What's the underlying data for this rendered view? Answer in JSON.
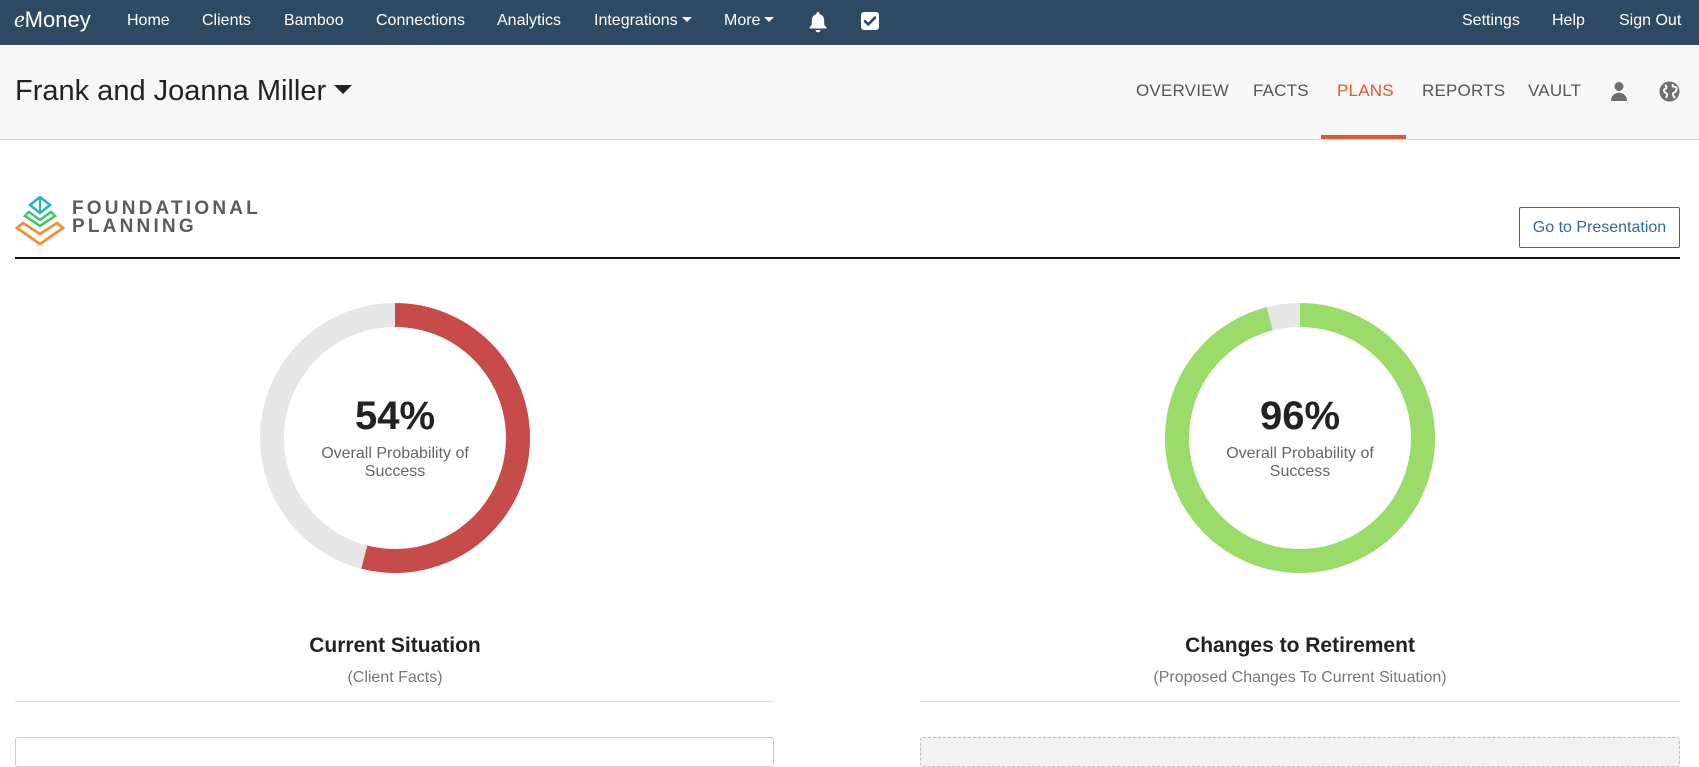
{
  "topnav": {
    "brand_e": "e",
    "brand_rest": "Money",
    "items": [
      {
        "label": "Home"
      },
      {
        "label": "Clients"
      },
      {
        "label": "Bamboo"
      },
      {
        "label": "Connections"
      },
      {
        "label": "Analytics"
      },
      {
        "label": "Integrations"
      },
      {
        "label": "More"
      }
    ],
    "right_items": [
      {
        "label": "Settings"
      },
      {
        "label": "Help"
      },
      {
        "label": "Sign Out"
      }
    ],
    "icons": [
      "bell-icon",
      "checkbox-icon"
    ]
  },
  "client": {
    "name": "Frank and Joanna Miller",
    "tabs": [
      {
        "label": "OVERVIEW"
      },
      {
        "label": "FACTS"
      },
      {
        "label": "PLANS"
      },
      {
        "label": "REPORTS"
      },
      {
        "label": "VAULT"
      }
    ],
    "active_tab": "PLANS",
    "icons": [
      "person-icon",
      "globe-icon"
    ]
  },
  "section": {
    "logo_line1": "FOUNDATIONAL",
    "logo_line2": "PLANNING",
    "present_button": "Go to Presentation"
  },
  "scenarios": [
    {
      "percent_label": "54%",
      "probability": 0.54,
      "caption": "Overall Probability of Success",
      "title": "Current Situation",
      "subtitle": "(Client Facts)",
      "color": "#c84b4b"
    },
    {
      "percent_label": "96%",
      "probability": 0.96,
      "caption": "Overall Probability of Success",
      "title": "Changes to Retirement",
      "subtitle": "(Proposed Changes To Current Situation)",
      "color": "#9bdb6a"
    }
  ],
  "colors": {
    "nav_bg": "#2e4a62",
    "accent": "#e0582f",
    "link_blue": "#2d6aa8",
    "track": "#e6e6e6"
  }
}
